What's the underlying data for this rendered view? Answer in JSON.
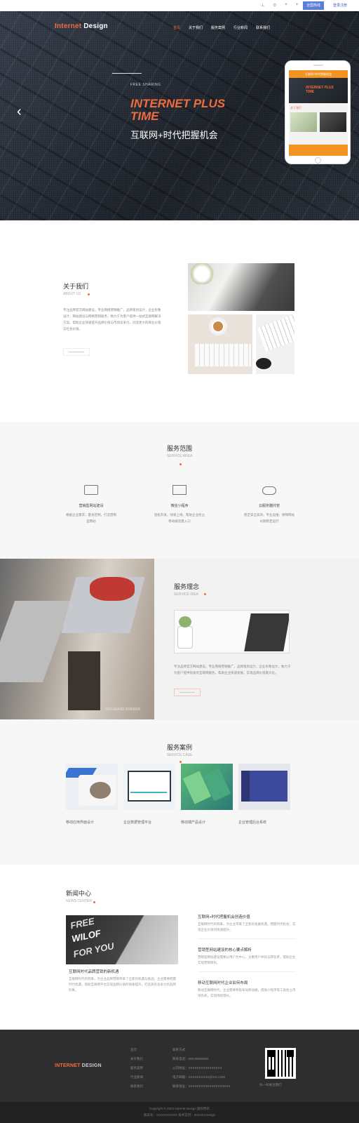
{
  "topbar": {
    "icon1": "⊥",
    "icon2": "⊙",
    "icon3": "+",
    "icon4": "+",
    "btn1": "全国热线",
    "btn2": "登录注册",
    "btn1_color": "#5b7fd6"
  },
  "hero": {
    "logo_a": "Internet",
    "logo_b": "Design",
    "nav": [
      "首页",
      "关于我们",
      "服务案例",
      "行业新闻",
      "联系我们"
    ],
    "kicker": "FREE SHARING",
    "headline": "INTERNET PLUS TIME",
    "tagline": "互联网+时代把握机会",
    "prev": "‹",
    "phone_bar": "互联网+时代把握机会",
    "phone_banner": "INTERNET PLUS TIME",
    "phone_tag": "关于我们"
  },
  "about": {
    "title": "关于我们",
    "subtitle": "ABOUT US",
    "text": "专注品牌官方网站建设，专业网络营销推广，品牌策划设计，企业形象设计，网站建设与网络营销服务，致力于为客户提供一站式互联网解决方案，帮助企业快速提升品牌价值与市场竞争力，创造更大的商业价值与社会价值。"
  },
  "service": {
    "title": "服务范围",
    "subtitle": "SERVICE AREA",
    "items": [
      {
        "icon": "chat-icon",
        "title": "营销型网站建设",
        "text": "根据企业需求，量身定制，打造营销型网站"
      },
      {
        "icon": "monitor-icon",
        "title": "微信小程序",
        "text": "轻松开发，快速上线，帮助企业抢占移动端流量入口"
      },
      {
        "icon": "cloud-icon",
        "title": "云服务器托管",
        "text": "稳定安全高效，专业运维，保障网站长期稳定运行"
      }
    ]
  },
  "concept": {
    "title": "服务理念",
    "subtitle": "SERVICE IDEA",
    "watermark": "HUSSBAND BOKEER",
    "text": "专注品牌官方网站建设，专业网络营销推广，品牌策划设计，企业形象设计，致力于为客户提供优质的互联网服务，帮助企业快速发展，实现品牌价值最大化。"
  },
  "cases": {
    "title": "服务案例",
    "subtitle": "SERVICE CASE",
    "items": [
      "移动应用界面设计",
      "企业数据管理平台",
      "移动端产品设计",
      "企业管理后台系统"
    ]
  },
  "news": {
    "title": "新闻中心",
    "subtitle": "NEWS CENTER",
    "feature_title": "互联网时代品牌营销的新机遇",
    "feature_text": "互联网时代的到来，为企业品牌营销带来了全新的机遇与挑战，企业需要把握时代机遇，借助互联网平台实现品牌价值的快速提升，打造具有竞争力的品牌形象。",
    "photo_words": [
      "FREE",
      "WILOF",
      "FOR YOU"
    ],
    "items": [
      {
        "title": "互联网+时代把握机会创造价值",
        "text": "互联网时代的到来，为企业带来了全新的发展机遇，把握时代机会，实现企业价值的快速提升。"
      },
      {
        "title": "营销型网站建设的核心要点解析",
        "text": "营销型网站建设需要以用户为中心，注重用户体验与转化率，帮助企业实现营销目标。"
      },
      {
        "title": "移动互联网时代企业如何布局",
        "text": "移动互联网时代，企业需要积极布局移动端，借助小程序等工具抢占市场先机，实现持续增长。"
      }
    ]
  },
  "footer": {
    "logo_a": "INTERNET",
    "logo_b": "DESIGN",
    "links": [
      "首页",
      "关于我们",
      "服务案例",
      "行业新闻",
      "联系我们"
    ],
    "contact": [
      "联系电话：000-00000000",
      "公司地址：XXXXXXXXXXXXXXXX",
      "电子邮箱：XXXXXXXXXX@XX.COM",
      "联系地址：XXXXXXXXXXXXXXXXXXXX"
    ],
    "contact_head": "联系方式",
    "qr_caption": "扫一扫关注我们",
    "copyright": "Copyright © 2023 Internet Design 版权所有",
    "icp": "备案号：XXXXXXXXXX 技术支持：Internet Design"
  },
  "colors": {
    "accent": "#f06b3e",
    "dark": "#2e2e2e"
  }
}
